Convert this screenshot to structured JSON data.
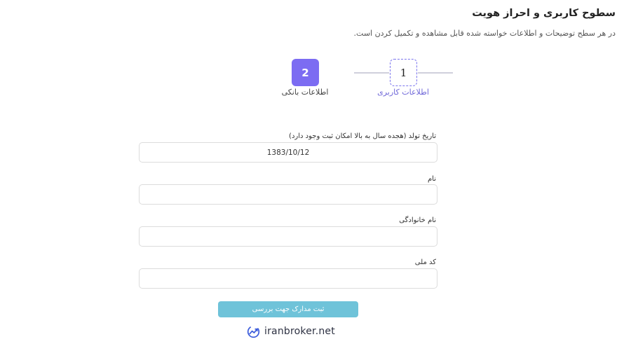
{
  "header": {
    "title": "سطوح کاربری و احراز هویت",
    "description": "در هر سطح توضیحات و اطلاعات خواسته شده قابل مشاهده و تکمیل کردن است."
  },
  "steps": [
    {
      "number": "1",
      "label": "اطلاعات کاربری"
    },
    {
      "number": "2",
      "label": "اطلاعات بانکی"
    }
  ],
  "form": {
    "birthdate": {
      "label": "تاریخ تولد (هجده سال به بالا امکان ثبت وجود دارد)",
      "value": "1383/10/12"
    },
    "first_name": {
      "label": "نام",
      "value": ""
    },
    "last_name": {
      "label": "نام خانوادگی",
      "value": ""
    },
    "national_code": {
      "label": "کد ملی",
      "value": ""
    },
    "submit_label": "ثبت مدارک جهت بررسی"
  },
  "brand": {
    "name": "iranbroker.net",
    "icon": "trend-chart-logo-icon"
  },
  "colors": {
    "accent": "#7c6cf2",
    "button": "#6fc3d9",
    "step_active_text": "#6f67d8"
  }
}
